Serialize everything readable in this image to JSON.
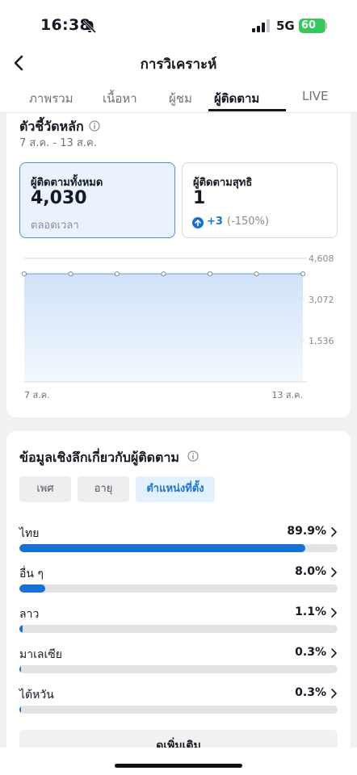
{
  "status_bar": {
    "time": "16:38",
    "network": "5G",
    "battery": "60"
  },
  "nav": {
    "title": "การวิเคราะห์"
  },
  "tabs": [
    {
      "label": "ภาพรวม",
      "active": false
    },
    {
      "label": "เนื้อหา",
      "active": false
    },
    {
      "label": "ผู้ชม",
      "active": false
    },
    {
      "label": "ผู้ติดตาม",
      "active": true
    },
    {
      "label": "LIVE",
      "active": false
    }
  ],
  "key_metrics": {
    "title": "ตัวชี้วัดหลัก",
    "date_range": "7 ส.ค. - 13 ส.ค.",
    "total_followers": {
      "label": "ผู้ติดตามทั้งหมด",
      "value": "4,030",
      "sub": "ตลอดเวลา"
    },
    "net_followers": {
      "label": "ผู้ติดตามสุทธิ",
      "value": "1",
      "delta": "+3",
      "delta_pct": "(-150%)"
    }
  },
  "chart_data": {
    "type": "area",
    "x": [
      "7 ส.ค.",
      "8 ส.ค.",
      "9 ส.ค.",
      "10 ส.ค.",
      "11 ส.ค.",
      "12 ส.ค.",
      "13 ส.ค."
    ],
    "values": [
      4030,
      4030,
      4030,
      4030,
      4030,
      4030,
      4030
    ],
    "x_tick_labels": [
      "7 ส.ค.",
      "13 ส.ค."
    ],
    "y_ticks": [
      "4,608",
      "3,072",
      "1,536"
    ],
    "ylim": [
      0,
      4608
    ],
    "grid": true,
    "colors": {
      "line": "#8fb6e6",
      "fill_top": "#cfe2f8",
      "fill_bottom": "#f3f8fe"
    }
  },
  "insights": {
    "title": "ข้อมูลเชิงลึกเกี่ยวกับผู้ติดตาม",
    "segments": [
      {
        "label": "เพศ",
        "active": false
      },
      {
        "label": "อายุ",
        "active": false
      },
      {
        "label": "ตำแหน่งที่ตั้ง",
        "active": true
      }
    ],
    "locations": [
      {
        "name": "ไทย",
        "pct_text": "89.9%",
        "pct": 89.9
      },
      {
        "name": "อื่น ๆ",
        "pct_text": "8.0%",
        "pct": 8.0
      },
      {
        "name": "ลาว",
        "pct_text": "1.1%",
        "pct": 1.1
      },
      {
        "name": "มาเลเซีย",
        "pct_text": "0.3%",
        "pct": 0.3
      },
      {
        "name": "ไต้หวัน",
        "pct_text": "0.3%",
        "pct": 0.3
      }
    ],
    "more_label": "ดูเพิ่มเติม"
  },
  "colors": {
    "accent": "#1671d6",
    "battery": "#34c759"
  }
}
